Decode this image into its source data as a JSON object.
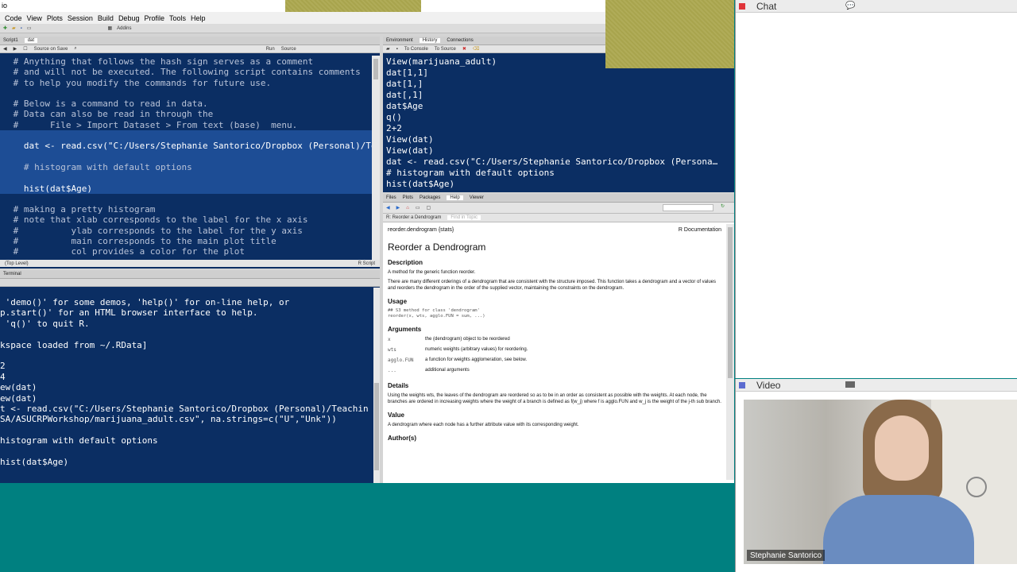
{
  "menubar": {
    "app_fragment": "io",
    "items": [
      "Code",
      "View",
      "Plots",
      "Session",
      "Build",
      "Debug",
      "Profile",
      "Tools",
      "Help"
    ]
  },
  "toolbar": {
    "addins": "Addins"
  },
  "source_pane": {
    "tabs": [
      "Script1",
      "dat"
    ],
    "toolbar": {
      "source_on_save": "Source on Save",
      "run": "Run",
      "source": "Source"
    },
    "lines": [
      {
        "text": " # Anything that follows the hash sign serves as a comment",
        "type": "comment"
      },
      {
        "text": " # and will not be executed. The following script contains comments",
        "type": "comment"
      },
      {
        "text": " # to help you modify the commands for future use.",
        "type": "comment"
      },
      {
        "text": "",
        "type": "blank"
      },
      {
        "text": " # Below is a command to read in data.",
        "type": "comment"
      },
      {
        "text": " # Data can also be read in through the",
        "type": "comment"
      },
      {
        "text": " #      File > Import Dataset > From text (base)  menu.",
        "type": "comment"
      },
      {
        "text": "",
        "type": "hl"
      },
      {
        "text": "   dat <- read.csv(\"C:/Users/Stephanie Santorico/Dropbox (Personal)/Te",
        "type": "hl"
      },
      {
        "text": "",
        "type": "hl"
      },
      {
        "text": "   # histogram with default options",
        "type": "hlcomment"
      },
      {
        "text": "",
        "type": "hl"
      },
      {
        "text": "   hist(dat$Age)",
        "type": "hl"
      },
      {
        "text": "",
        "type": "blank"
      },
      {
        "text": " # making a pretty histogram",
        "type": "comment"
      },
      {
        "text": " # note that xlab corresponds to the label for the x axis",
        "type": "comment"
      },
      {
        "text": " #          ylab corresponds to the label for the y axis",
        "type": "comment"
      },
      {
        "text": " #          main corresponds to the main plot title",
        "type": "comment"
      },
      {
        "text": " #          col provides a color for the plot",
        "type": "comment"
      }
    ],
    "status_left": "(Top Level)",
    "status_right": "R Script"
  },
  "console_pane": {
    "tabs": [
      "Terminal"
    ],
    "lines": [
      " 'demo()' for some demos, 'help()' for on-line help, or",
      "p.start()' for an HTML browser interface to help.",
      " 'q()' to quit R.",
      "",
      "kspace loaded from ~/.RData]",
      "",
      "2",
      "4",
      "ew(dat)",
      "ew(dat)",
      "t <- read.csv(\"C:/Users/Stephanie Santorico/Dropbox (Personal)/Teachin",
      "SA/ASUCRPWorkshop/marijuana_adult.csv\", na.strings=c(\"U\",\"Unk\"))",
      "",
      "histogram with default options",
      "",
      "hist(dat$Age)"
    ]
  },
  "history_pane": {
    "tabs": [
      "Environment",
      "History",
      "Connections"
    ],
    "toolbar": {
      "to_console": "To Console",
      "to_source": "To Source"
    },
    "lines": [
      "View(marijuana_adult)",
      "dat[1,1]",
      "dat[1,]",
      "dat[,1]",
      "dat$Age",
      "q()",
      "2+2",
      "View(dat)",
      "View(dat)",
      "dat <- read.csv(\"C:/Users/Stephanie Santorico/Dropbox (Persona…",
      "# histogram with default options",
      "hist(dat$Age)"
    ]
  },
  "help_pane": {
    "tabs": [
      "Files",
      "Plots",
      "Packages",
      "Help",
      "Viewer"
    ],
    "topic_dropdown": "R: Reorder a Dendrogram",
    "find_in_topic": "Find in Topic",
    "header_left": "reorder.dendrogram {stats}",
    "header_right": "R Documentation",
    "title": "Reorder a Dendrogram",
    "description_h": "Description",
    "description_1": "A method for the generic function reorder.",
    "description_2": "There are many different orderings of a dendrogram that are consistent with the structure imposed. This function takes a dendrogram and a vector of values and reorders the dendrogram in the order of the supplied vector, maintaining the constraints on the dendrogram.",
    "usage_h": "Usage",
    "usage_1": "## S3 method for class 'dendrogram'",
    "usage_2": "reorder(x, wts, agglo.FUN = sum, ...)",
    "arguments_h": "Arguments",
    "arguments": [
      {
        "name": "x",
        "desc": "the (dendrogram) object to be reordered"
      },
      {
        "name": "wts",
        "desc": "numeric weights (arbitrary values) for reordering."
      },
      {
        "name": "agglo.FUN",
        "desc": "a function for weights agglomeration, see below."
      },
      {
        "name": "...",
        "desc": "additional arguments"
      }
    ],
    "details_h": "Details",
    "details": "Using the weights wts, the leaves of the dendrogram are reordered so as to be in an order as consistent as possible with the weights. At each node, the branches are ordered in increasing weights where the weight of a branch is defined as f(w_j) where f is agglo.FUN and w_j is the weight of the j-th sub branch.",
    "value_h": "Value",
    "value": "A dendrogram where each node has a further attribute value with its corresponding weight.",
    "authors_h": "Author(s)"
  },
  "chat": {
    "title": "Chat"
  },
  "video": {
    "title": "Video",
    "participant_name": "Stephanie Santorico"
  },
  "colors": {
    "editor_bg": "#0b2e63",
    "selection": "#1d4d95",
    "desktop": "#008080",
    "record_dot": "#e0343a"
  }
}
